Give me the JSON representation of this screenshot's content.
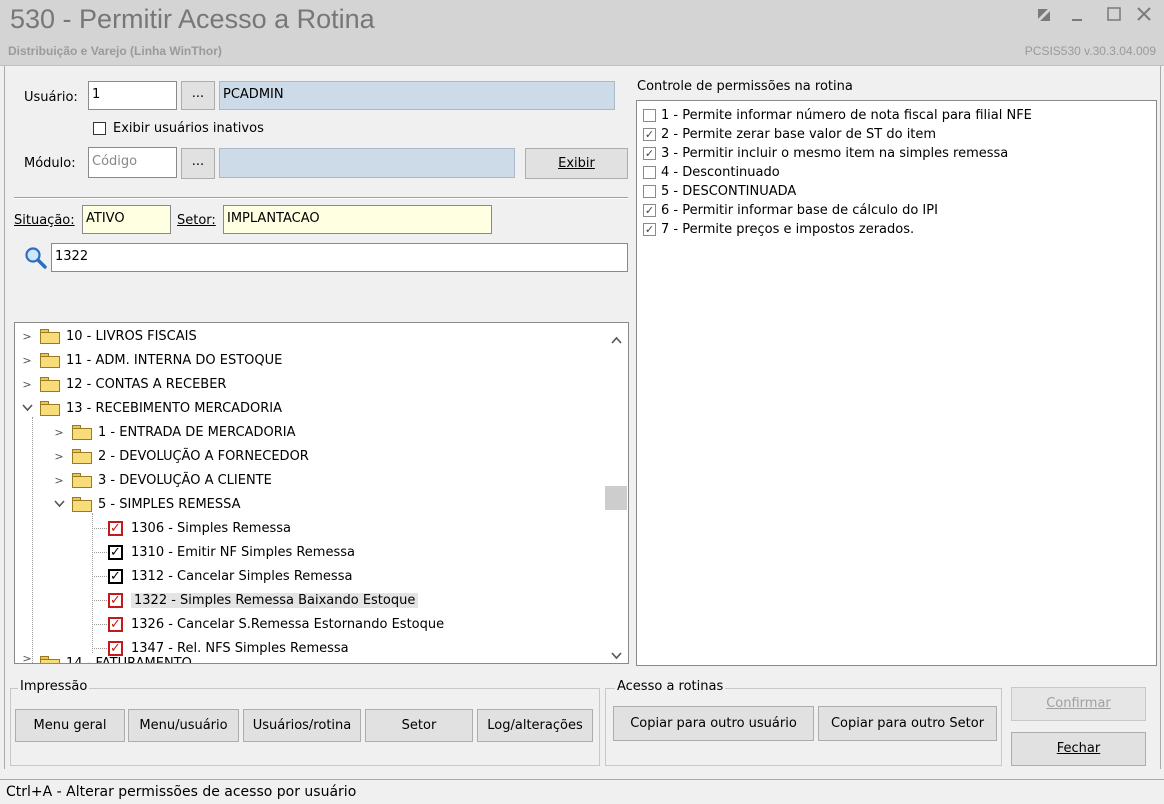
{
  "window": {
    "title": "530 - Permitir Acesso a Rotina",
    "subtitle": "Distribuição e Varejo (Linha WinThor)",
    "version": "PCSIS530  v.30.3.04.009"
  },
  "form": {
    "usuario_label": "Usuário:",
    "usuario_code": "1",
    "ellipsis": "...",
    "usuario_name": "PCADMIN",
    "inativos_label": "Exibir usuários inativos",
    "modulo_label": "Módulo:",
    "modulo_placeholder": "Código",
    "modulo_name": "",
    "exibir_button": "Exibir",
    "situacao_label": "Situação:",
    "situacao_value": "ATIVO",
    "setor_label": "Setor:",
    "setor_value": "IMPLANTACAO",
    "search_value": "1322"
  },
  "tree": {
    "nodes": [
      {
        "label": "10 - LIVROS FISCAIS"
      },
      {
        "label": "11 - ADM. INTERNA DO ESTOQUE"
      },
      {
        "label": "12 - CONTAS A RECEBER"
      },
      {
        "label": "13 - RECEBIMENTO MERCADORIA"
      },
      {
        "label": "1 - ENTRADA DE MERCADORIA"
      },
      {
        "label": "2 - DEVOLUÇÃO A FORNECEDOR"
      },
      {
        "label": "3 - DEVOLUÇÃO A CLIENTE"
      },
      {
        "label": "5 - SIMPLES REMESSA"
      },
      {
        "label": "1306 - Simples Remessa"
      },
      {
        "label": "1310 - Emitir NF Simples Remessa"
      },
      {
        "label": "1312 - Cancelar Simples Remessa"
      },
      {
        "label": "1322 - Simples Remessa Baixando Estoque"
      },
      {
        "label": "1326 - Cancelar S.Remessa Estornando Estoque"
      },
      {
        "label": "1347 - Rel. NFS Simples Remessa"
      },
      {
        "label": "14 - FATURAMENTO"
      }
    ],
    "check_mark": "✓"
  },
  "permissions": {
    "title": "Controle de permissões na rotina",
    "items": [
      {
        "label": "1 - Permite informar número de nota fiscal para filial NFE",
        "checked": false
      },
      {
        "label": "2 - Permite zerar base valor de ST do item",
        "checked": true
      },
      {
        "label": "3 - Permitir incluir o mesmo item na simples remessa",
        "checked": true
      },
      {
        "label": "4 - Descontinuado",
        "checked": false
      },
      {
        "label": "5 - DESCONTINUADA",
        "checked": false
      },
      {
        "label": "6 - Permitir informar base de cálculo do IPI",
        "checked": true
      },
      {
        "label": "7 - Permite preços e impostos zerados.",
        "checked": true
      }
    ],
    "checked_mark": "✓",
    "unchecked_mark": ""
  },
  "impressao": {
    "title": "Impressão",
    "buttons": [
      "Menu geral",
      "Menu/usuário",
      "Usuários/rotina",
      "Setor",
      "Log/alterações"
    ]
  },
  "acesso": {
    "title": "Acesso a rotinas",
    "copy_user": "Copiar para outro usuário",
    "copy_setor": "Copiar para outro Setor"
  },
  "actions": {
    "confirmar": "Confirmar",
    "fechar": "Fechar"
  },
  "status": {
    "text": "Ctrl+A - Alterar permissões de acesso por usuário"
  },
  "icons": {
    "search": "magnifier-icon",
    "folder": "folder-icon",
    "min": "minimize-icon",
    "max": "maximize-icon",
    "close": "close-icon",
    "restore": "restore-icon"
  }
}
